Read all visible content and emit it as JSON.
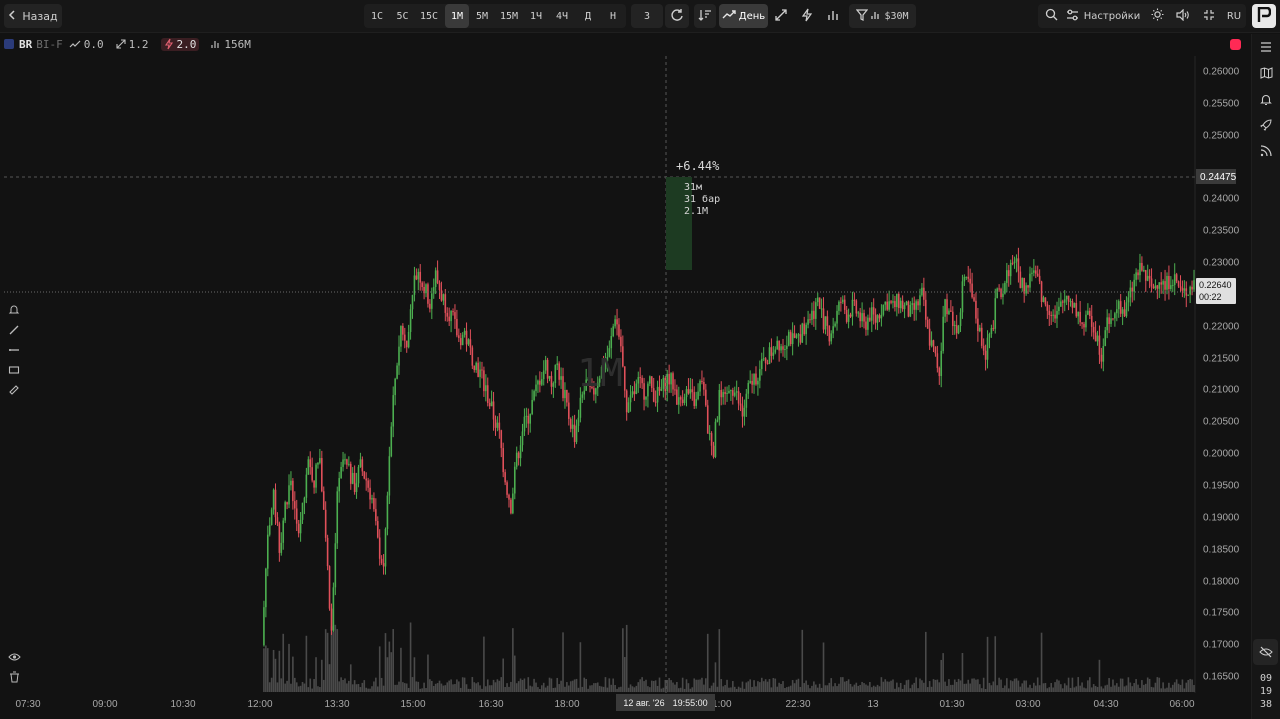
{
  "topbar": {
    "back_label": "Назад",
    "timeframes": [
      "1С",
      "5С",
      "15С",
      "1М",
      "5М",
      "15М",
      "1Ч",
      "4Ч",
      "Д",
      "Н"
    ],
    "active_timeframe": "1М",
    "counter_value": "3",
    "day_label": "День",
    "volume_filter_label": "$30M",
    "settings_label": "Настройки",
    "lang_label": "RU"
  },
  "info": {
    "symbol": "BR",
    "market": "BI-F",
    "trend_value": "0.0",
    "diagonal_value": "1.2",
    "volatility_value": "2.0",
    "volume_value": "156M"
  },
  "chart": {
    "watermark": "1M",
    "measure_percent": "+6.44%",
    "measure_duration": "31м",
    "measure_bars": "31 бар",
    "measure_volume": "2.1M",
    "high_price_tag": "0.24475",
    "current_price_tag": "0.22640",
    "countdown_tag": "00:22",
    "crosshair_time": "12 авг. '26",
    "crosshair_clock": "19:55:00",
    "up_color": "#4caf50",
    "down_color": "#e0505a"
  },
  "price_axis": [
    "0.26000",
    "0.25500",
    "0.25000",
    "0.24000",
    "0.23500",
    "0.23000",
    "0.22000",
    "0.21500",
    "0.21000",
    "0.20500",
    "0.20000",
    "0.19500",
    "0.19000",
    "0.18500",
    "0.18000",
    "0.17500",
    "0.17000",
    "0.16500"
  ],
  "time_axis": [
    "07:30",
    "09:00",
    "10:30",
    "12:00",
    "13:30",
    "15:00",
    "16:30",
    "18:00",
    "21:00",
    "22:30",
    "13",
    "01:30",
    "03:00",
    "04:30",
    "06:00"
  ],
  "clock": [
    "09",
    "19",
    "38"
  ],
  "chart_data": {
    "type": "candlestick",
    "x_start": "12:00",
    "ylim": [
      0.1625,
      0.2625
    ],
    "close_series": [
      0.17,
      0.188,
      0.193,
      0.185,
      0.192,
      0.196,
      0.188,
      0.191,
      0.198,
      0.196,
      0.2,
      0.187,
      0.172,
      0.193,
      0.199,
      0.197,
      0.195,
      0.198,
      0.196,
      0.193,
      0.186,
      0.182,
      0.2,
      0.212,
      0.22,
      0.218,
      0.226,
      0.229,
      0.226,
      0.224,
      0.228,
      0.225,
      0.223,
      0.221,
      0.218,
      0.219,
      0.216,
      0.214,
      0.212,
      0.209,
      0.206,
      0.203,
      0.196,
      0.192,
      0.199,
      0.204,
      0.206,
      0.209,
      0.212,
      0.214,
      0.211,
      0.214,
      0.21,
      0.206,
      0.203,
      0.208,
      0.211,
      0.209,
      0.212,
      0.214,
      0.216,
      0.222,
      0.217,
      0.206,
      0.209,
      0.211,
      0.21,
      0.211,
      0.209,
      0.21,
      0.212,
      0.211,
      0.208,
      0.21,
      0.209,
      0.208,
      0.212,
      0.204,
      0.201,
      0.209,
      0.208,
      0.211,
      0.209,
      0.206,
      0.21,
      0.212,
      0.213,
      0.215,
      0.216,
      0.218,
      0.217,
      0.219,
      0.217,
      0.219,
      0.221,
      0.222,
      0.224,
      0.221,
      0.219,
      0.221,
      0.224,
      0.222,
      0.223,
      0.222,
      0.22,
      0.222,
      0.221,
      0.223,
      0.224,
      0.223,
      0.224,
      0.223,
      0.222,
      0.223,
      0.225,
      0.219,
      0.216,
      0.213,
      0.224,
      0.222,
      0.219,
      0.226,
      0.227,
      0.223,
      0.219,
      0.216,
      0.219,
      0.225,
      0.226,
      0.229,
      0.231,
      0.227,
      0.226,
      0.229,
      0.227,
      0.224,
      0.223,
      0.221,
      0.223,
      0.225,
      0.224,
      0.222,
      0.22,
      0.222,
      0.219,
      0.216,
      0.22,
      0.221,
      0.224,
      0.222,
      0.225,
      0.228,
      0.229,
      0.227,
      0.226,
      0.228,
      0.226,
      0.228,
      0.227,
      0.225,
      0.226,
      0.227
    ]
  }
}
